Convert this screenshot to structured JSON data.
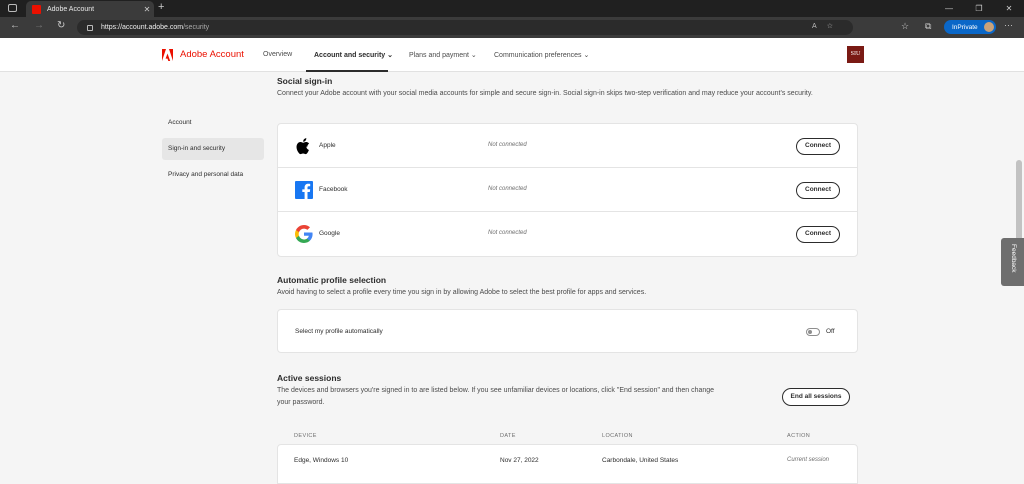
{
  "browser": {
    "tab_title": "Adobe Account",
    "url_host": "https://account.adobe.com",
    "url_path": "/security",
    "inprivate_label": "InPrivate"
  },
  "header": {
    "brand": "Adobe Account",
    "nav": [
      "Overview",
      "Account and security",
      "Plans and payment",
      "Communication preferences"
    ],
    "org_badge": "SIU"
  },
  "sidebar": {
    "items": [
      "Account",
      "Sign-in and security",
      "Privacy and personal data"
    ]
  },
  "social": {
    "title": "Social sign-in",
    "description": "Connect your Adobe account with your social media accounts for simple and secure sign-in. Social sign-in skips two-step verification and may reduce your account's security.",
    "providers": [
      {
        "name": "Apple",
        "status": "Not connected",
        "action": "Connect",
        "icon": "apple-icon"
      },
      {
        "name": "Facebook",
        "status": "Not connected",
        "action": "Connect",
        "icon": "facebook-icon"
      },
      {
        "name": "Google",
        "status": "Not connected",
        "action": "Connect",
        "icon": "google-icon"
      }
    ]
  },
  "profile": {
    "title": "Automatic profile selection",
    "description": "Avoid having to select a profile every time you sign in by allowing Adobe to select the best profile for apps and services.",
    "option_label": "Select my profile automatically",
    "toggle_state": "Off"
  },
  "sessions": {
    "title": "Active sessions",
    "description": "The devices and browsers you're signed in to are listed below. If you see unfamiliar devices or locations, click \"End session\" and then change your password.",
    "end_all_label": "End all sessions",
    "columns": [
      "DEVICE",
      "DATE",
      "LOCATION",
      "ACTION"
    ],
    "rows": [
      {
        "device": "Edge, Windows 10",
        "date": "Nov 27, 2022",
        "location": "Carbondale, United States",
        "action": "Current session"
      }
    ]
  },
  "feedback_label": "Feedback"
}
